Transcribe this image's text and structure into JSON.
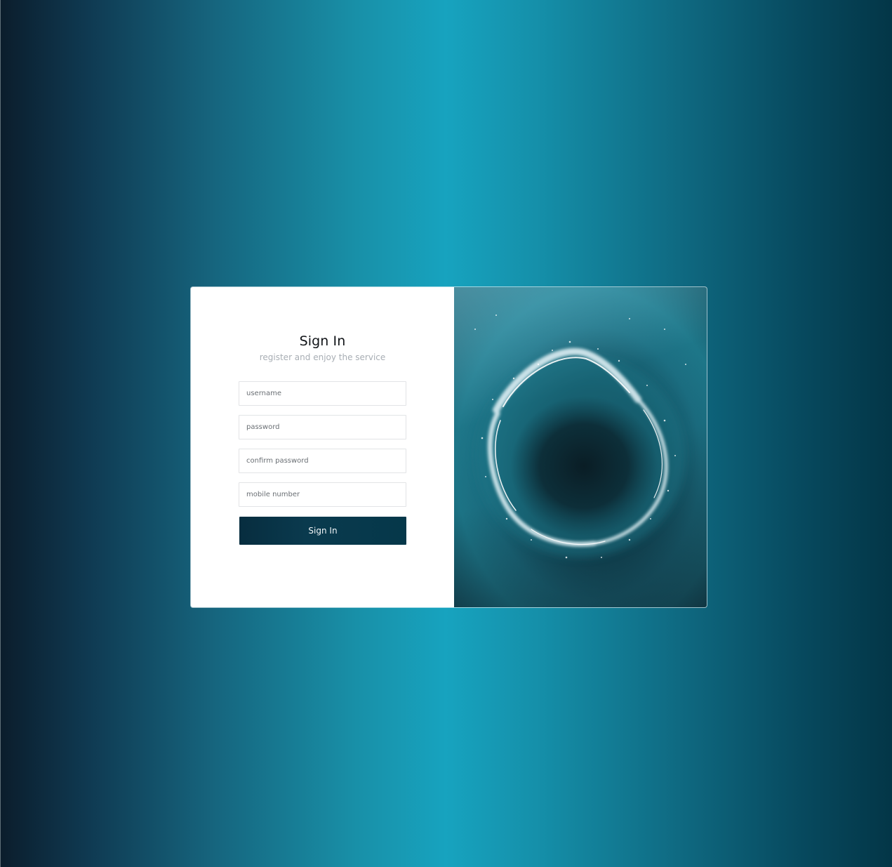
{
  "form": {
    "title": "Sign In",
    "subtitle": "register and enjoy the service",
    "fields": [
      {
        "placeholder": "username",
        "value": ""
      },
      {
        "placeholder": "password",
        "value": ""
      },
      {
        "placeholder": "confirm password",
        "value": ""
      },
      {
        "placeholder": "mobile number",
        "value": ""
      }
    ],
    "submit_label": "Sign In"
  },
  "image": {
    "subject": "ocean-wave-circle"
  },
  "colors": {
    "button": "#08364a",
    "background_center": "#17a3bf",
    "background_edge": "#0b1d2c"
  }
}
